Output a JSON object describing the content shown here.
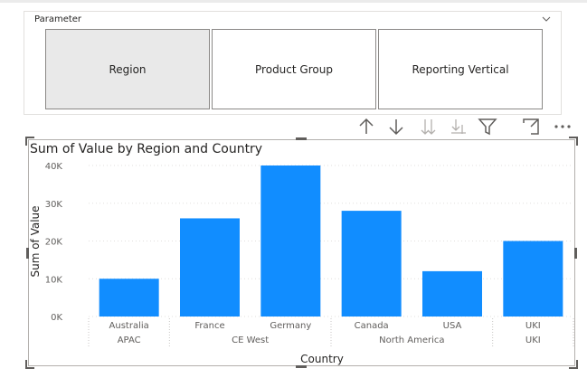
{
  "slicer": {
    "header": "Parameter",
    "options": [
      {
        "label": "Region",
        "selected": true
      },
      {
        "label": "Product Group",
        "selected": false
      },
      {
        "label": "Reporting Vertical",
        "selected": false
      }
    ]
  },
  "visual_header_icons": [
    "drill-up-icon",
    "drill-down-icon",
    "go-to-next-level-icon",
    "expand-all-down-icon",
    "filter-icon",
    "focus-mode-icon",
    "more-options-icon"
  ],
  "chart_data": {
    "type": "bar",
    "title": "Sum of Value by Region and Country",
    "xlabel": "Country",
    "ylabel": "Sum of Value",
    "ylim": [
      0,
      40000
    ],
    "yticks": [
      "0K",
      "10K",
      "20K",
      "30K",
      "40K"
    ],
    "ytick_values": [
      0,
      10000,
      20000,
      30000,
      40000
    ],
    "categories": [
      "Australia",
      "France",
      "Germany",
      "Canada",
      "USA",
      "UKI"
    ],
    "groups": [
      {
        "name": "APAC",
        "categories": [
          "Australia"
        ]
      },
      {
        "name": "CE West",
        "categories": [
          "France",
          "Germany"
        ]
      },
      {
        "name": "North America",
        "categories": [
          "Canada",
          "USA"
        ]
      },
      {
        "name": "UKI",
        "categories": [
          "UKI"
        ]
      }
    ],
    "values": [
      10000,
      26000,
      40000,
      28000,
      12000,
      20000
    ],
    "bar_color": "#118DFF",
    "grid": true
  }
}
